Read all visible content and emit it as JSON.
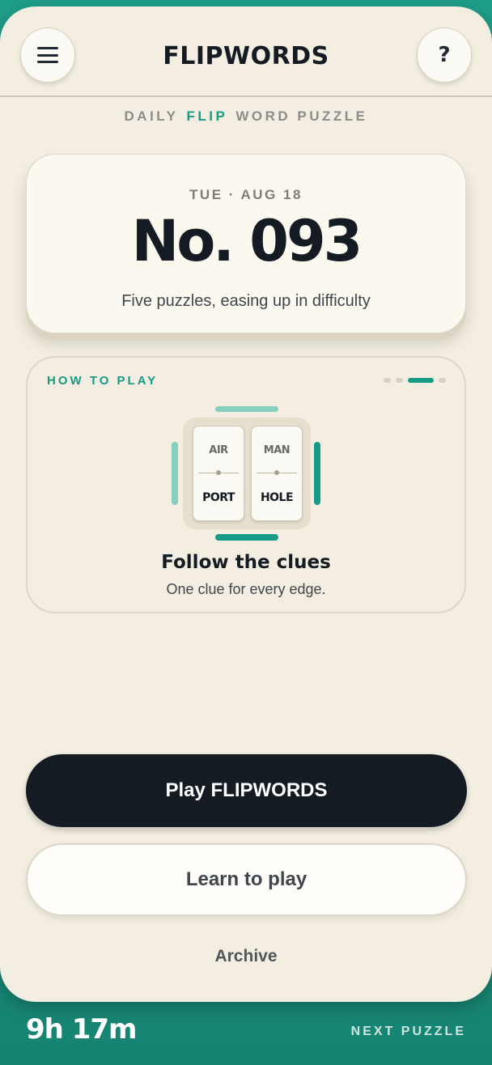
{
  "header": {
    "title": "FLIPWORDS",
    "menu_icon": "hamburger-menu-icon",
    "help_glyph": "?",
    "help_icon": "question-mark-icon"
  },
  "subtitle": {
    "part1": "DAILY",
    "part2": "FLIP",
    "part3": "WORD PUZZLE"
  },
  "puzzle": {
    "date": "TUE · AUG 18",
    "number": "No. 093",
    "description": "Five puzzles, easing up in difficulty"
  },
  "how_to_play": {
    "label": "HOW TO PLAY",
    "carousel_pages": 4,
    "carousel_active_index": 2,
    "tiles": [
      {
        "top": "AIR",
        "bottom": "PORT"
      },
      {
        "top": "MAN",
        "bottom": "HOLE"
      }
    ],
    "title": "Follow the clues",
    "text": "One clue for every edge."
  },
  "actions": {
    "play_label": "Play FLIPWORDS",
    "learn_label": "Learn to play",
    "archive_label": "Archive"
  },
  "footer": {
    "countdown": "9h 17m",
    "next_label": "NEXT PUZZLE"
  },
  "colors": {
    "accent": "#159b86",
    "background": "#f3eee1",
    "dark": "#141b22",
    "footer": "#1c8f7d"
  }
}
